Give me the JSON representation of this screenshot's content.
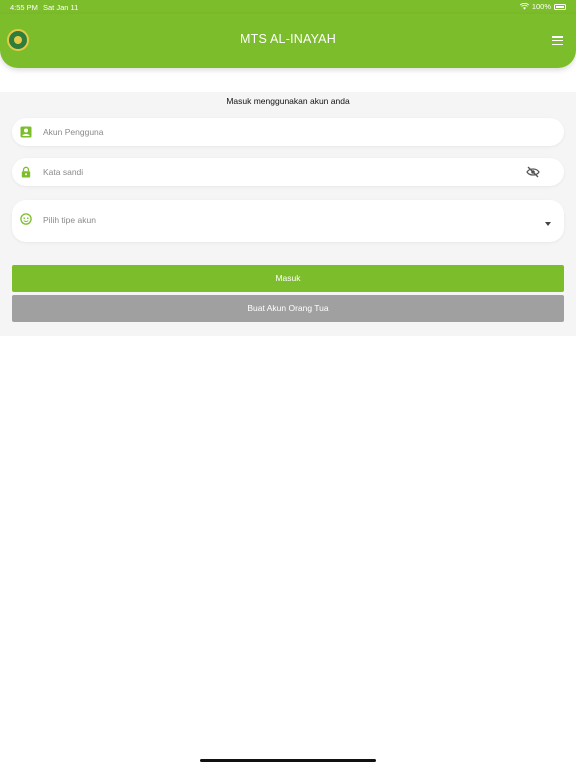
{
  "status_bar": {
    "time": "4:55 PM",
    "date": "Sat Jan 11",
    "battery": "100%"
  },
  "header": {
    "title": "MTS AL-INAYAH",
    "logo_icon": "school-logo-icon",
    "menu_icon": "hamburger-menu-icon"
  },
  "colors": {
    "primary": "#7cbd2b",
    "secondary_button": "#a0a0a0",
    "panel_bg": "#f5f5f5"
  },
  "form": {
    "prompt": "Masuk menggunakan akun anda",
    "username": {
      "placeholder": "Akun Pengguna",
      "icon": "account-box-icon"
    },
    "password": {
      "placeholder": "Kata sandi",
      "icon": "lock-icon",
      "toggle_icon": "eye-off-icon"
    },
    "account_type": {
      "placeholder": "Pilih tipe akun",
      "icon": "face-icon",
      "dropdown_icon": "caret-down-icon"
    }
  },
  "buttons": {
    "login": "Masuk",
    "create_parent": "Buat Akun Orang Tua"
  }
}
